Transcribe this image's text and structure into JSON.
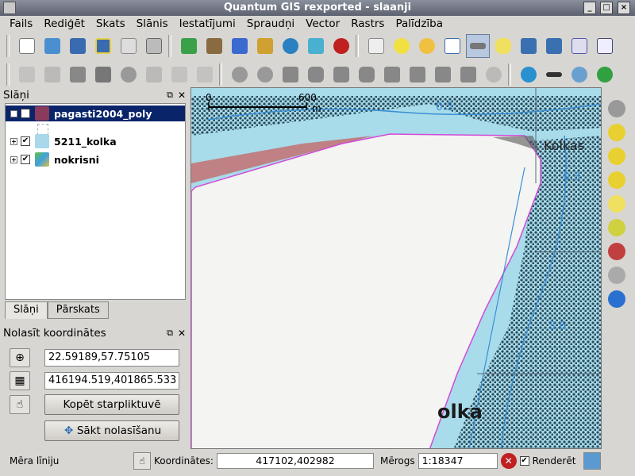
{
  "window": {
    "title": "Quantum GIS rexported - slaanji"
  },
  "menu": [
    "Fails",
    "Rediģēt",
    "Skats",
    "Slānis",
    "Iestatījumi",
    "Spraudņi",
    "Vector",
    "Rastrs",
    "Palīdzība"
  ],
  "layers_panel": {
    "title": "Slāņi",
    "layers": [
      {
        "name": "pagasti2004_poly",
        "checked": true,
        "selected": true,
        "icon": "polygon-layer-icon"
      },
      {
        "name": "5211_kolka",
        "checked": true,
        "selected": false,
        "icon": "raster-layer-icon"
      },
      {
        "name": "nokrisni",
        "checked": true,
        "selected": false,
        "icon": "raster-layer-icon"
      }
    ],
    "tabs": [
      "Slāņi",
      "Pārskats"
    ]
  },
  "coord_panel": {
    "title": "Nolasīt koordinātes",
    "geo_coords": "22.59189,57.75105",
    "proj_coords": "416194.519,401865.533",
    "copy_button": "Kopēt starpliktuvē",
    "start_button": "Sākt nolasīšanu"
  },
  "map": {
    "scalebar_start": "0",
    "scalebar_end": "600",
    "scalebar_unit": "m",
    "labels": [
      "0.5",
      "Kolkas",
      "0.3",
      "3.6",
      "olka"
    ]
  },
  "status": {
    "left_text": "Mēra līniju",
    "coords_label": "Koordinātes:",
    "coords_value": "417102,402982",
    "scale_label": "Mērogs",
    "scale_value": "1:18347",
    "render_label": "Renderēt",
    "render_checked": true
  },
  "colors": {
    "water": "#a8dcea",
    "land": "#f4f4f2",
    "selection": "#0a246a",
    "contour": "#3a8fd6",
    "polygon_outline": "#d04bd8"
  }
}
